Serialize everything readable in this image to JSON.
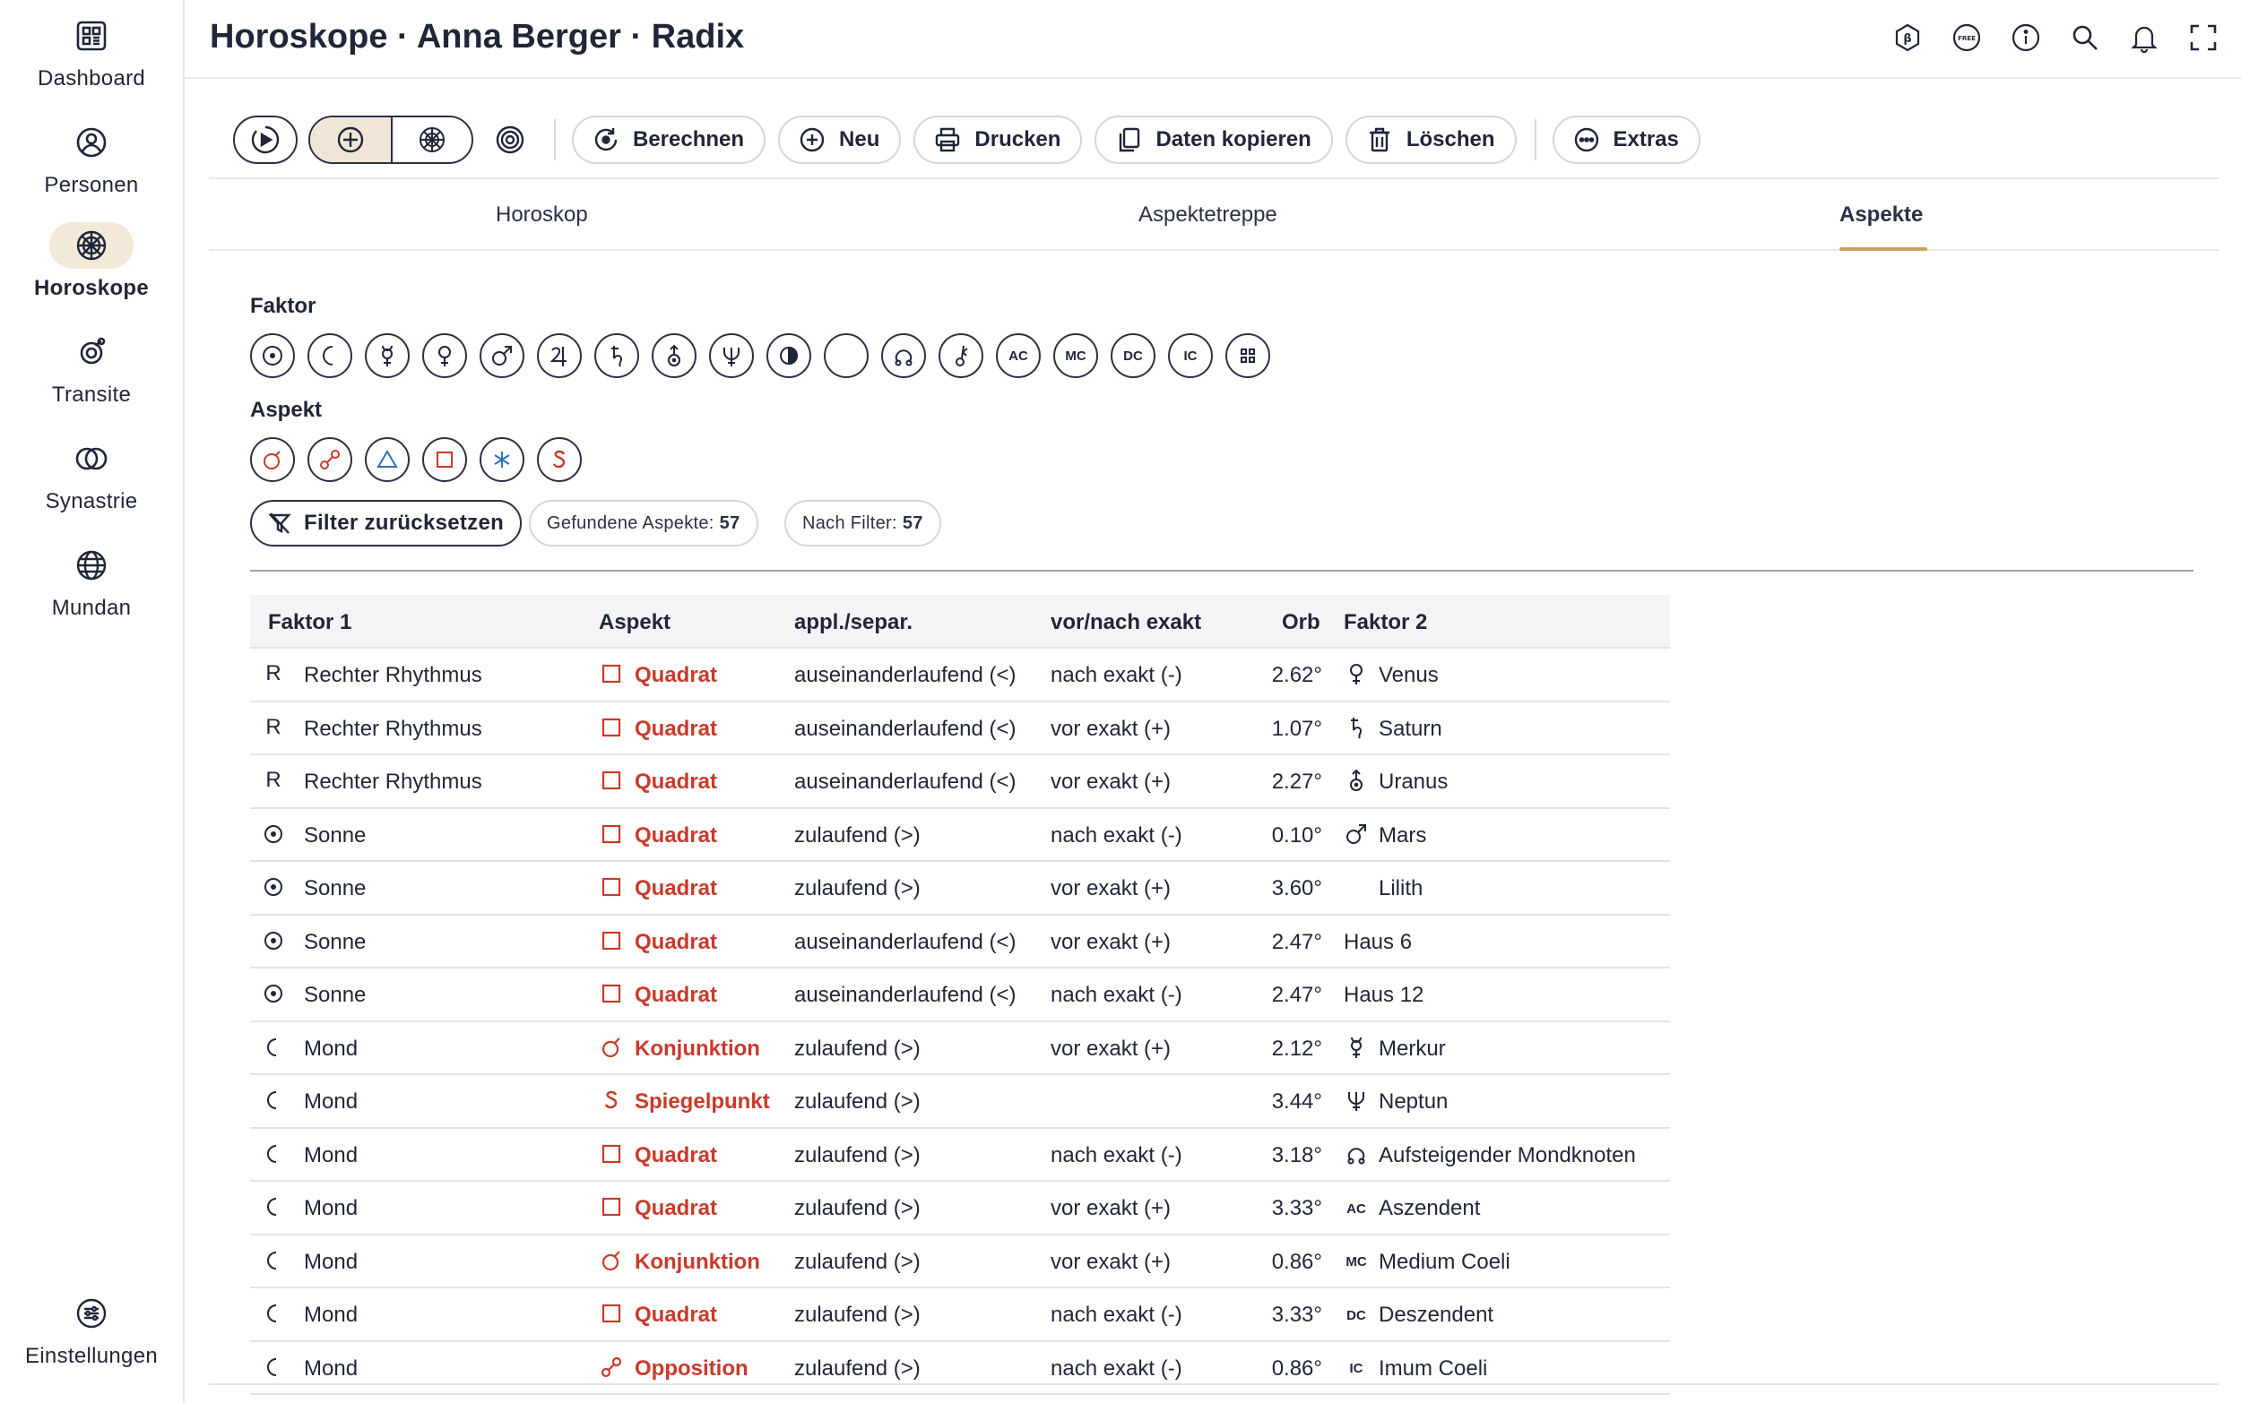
{
  "sidebar": {
    "items": [
      {
        "label": "Dashboard",
        "icon": "dashboard-icon"
      },
      {
        "label": "Personen",
        "icon": "person-icon"
      },
      {
        "label": "Horoskope",
        "icon": "horoscope-wheel-icon",
        "active": true
      },
      {
        "label": "Transite",
        "icon": "transit-icon"
      },
      {
        "label": "Synastrie",
        "icon": "synastry-icon"
      },
      {
        "label": "Mundan",
        "icon": "globe-icon"
      }
    ],
    "settings_label": "Einstellungen"
  },
  "header": {
    "title": "Horoskope · Anna Berger · Radix",
    "icons": [
      "beta-icon",
      "free-icon",
      "info-icon",
      "search-icon",
      "bell-icon",
      "fullscreen-icon"
    ]
  },
  "toolbar": {
    "berechnen": "Berechnen",
    "neu": "Neu",
    "drucken": "Drucken",
    "daten_kopieren": "Daten kopieren",
    "loeschen": "Löschen",
    "extras": "Extras"
  },
  "tabs": [
    {
      "label": "Horoskop"
    },
    {
      "label": "Aspektetreppe"
    },
    {
      "label": "Aspekte",
      "active": true
    }
  ],
  "filters": {
    "faktor_label": "Faktor",
    "aspekt_label": "Aspekt",
    "faktor_chips": [
      "sun",
      "moon",
      "mercury",
      "venus",
      "mars",
      "jupiter",
      "saturn",
      "uranus",
      "neptune",
      "pluto",
      "lilith",
      "node",
      "chiron",
      "AC",
      "MC",
      "DC",
      "IC",
      "more"
    ],
    "aspekt_chips": [
      "conjunction",
      "opposition",
      "trine",
      "square",
      "sextile",
      "mirror"
    ],
    "reset_label": "Filter zurücksetzen",
    "found_label": "Gefundene Aspekte:",
    "found_count": "57",
    "after_filter_label": "Nach Filter:",
    "after_filter_count": "57"
  },
  "table": {
    "headers": {
      "faktor1": "Faktor 1",
      "aspekt": "Aspekt",
      "appl": "appl./separ.",
      "vornach": "vor/nach exakt",
      "orb": "Orb",
      "faktor2": "Faktor 2"
    },
    "rows": [
      {
        "f1_sym": "R",
        "f1": "Rechter Rhythmus",
        "asp_sym": "square",
        "asp": "Quadrat",
        "appl": "auseinanderlaufend (<)",
        "vn": "nach exakt (-)",
        "orb": "2.62°",
        "f2_sym": "venus",
        "f2": "Venus"
      },
      {
        "f1_sym": "R",
        "f1": "Rechter Rhythmus",
        "asp_sym": "square",
        "asp": "Quadrat",
        "appl": "auseinanderlaufend (<)",
        "vn": "vor exakt (+)",
        "orb": "1.07°",
        "f2_sym": "saturn",
        "f2": "Saturn"
      },
      {
        "f1_sym": "R",
        "f1": "Rechter Rhythmus",
        "asp_sym": "square",
        "asp": "Quadrat",
        "appl": "auseinanderlaufend (<)",
        "vn": "vor exakt (+)",
        "orb": "2.27°",
        "f2_sym": "uranus",
        "f2": "Uranus"
      },
      {
        "f1_sym": "sun",
        "f1": "Sonne",
        "asp_sym": "square",
        "asp": "Quadrat",
        "appl": "zulaufend (>)",
        "vn": "nach exakt (-)",
        "orb": "0.10°",
        "f2_sym": "mars",
        "f2": "Mars"
      },
      {
        "f1_sym": "sun",
        "f1": "Sonne",
        "asp_sym": "square",
        "asp": "Quadrat",
        "appl": "zulaufend (>)",
        "vn": "vor exakt (+)",
        "orb": "3.60°",
        "f2_sym": "lilith",
        "f2": "Lilith"
      },
      {
        "f1_sym": "sun",
        "f1": "Sonne",
        "asp_sym": "square",
        "asp": "Quadrat",
        "appl": "auseinanderlaufend (<)",
        "vn": "vor exakt (+)",
        "orb": "2.47°",
        "f2_sym": "",
        "f2": "Haus 6"
      },
      {
        "f1_sym": "sun",
        "f1": "Sonne",
        "asp_sym": "square",
        "asp": "Quadrat",
        "appl": "auseinanderlaufend (<)",
        "vn": "nach exakt (-)",
        "orb": "2.47°",
        "f2_sym": "",
        "f2": "Haus 12"
      },
      {
        "f1_sym": "moon",
        "f1": "Mond",
        "asp_sym": "conjunction",
        "asp": "Konjunktion",
        "appl": "zulaufend (>)",
        "vn": "vor exakt (+)",
        "orb": "2.12°",
        "f2_sym": "mercury",
        "f2": "Merkur"
      },
      {
        "f1_sym": "moon",
        "f1": "Mond",
        "asp_sym": "mirror",
        "asp": "Spiegelpunkt",
        "appl": "zulaufend (>)",
        "vn": "",
        "orb": "3.44°",
        "f2_sym": "neptune",
        "f2": "Neptun"
      },
      {
        "f1_sym": "moon",
        "f1": "Mond",
        "asp_sym": "square",
        "asp": "Quadrat",
        "appl": "zulaufend (>)",
        "vn": "nach exakt (-)",
        "orb": "3.18°",
        "f2_sym": "node",
        "f2": "Aufsteigender Mondknoten"
      },
      {
        "f1_sym": "moon",
        "f1": "Mond",
        "asp_sym": "square",
        "asp": "Quadrat",
        "appl": "zulaufend (>)",
        "vn": "vor exakt (+)",
        "orb": "3.33°",
        "f2_sym": "AC",
        "f2": "Aszendent"
      },
      {
        "f1_sym": "moon",
        "f1": "Mond",
        "asp_sym": "conjunction",
        "asp": "Konjunktion",
        "appl": "zulaufend (>)",
        "vn": "vor exakt (+)",
        "orb": "0.86°",
        "f2_sym": "MC",
        "f2": "Medium Coeli"
      },
      {
        "f1_sym": "moon",
        "f1": "Mond",
        "asp_sym": "square",
        "asp": "Quadrat",
        "appl": "zulaufend (>)",
        "vn": "nach exakt (-)",
        "orb": "3.33°",
        "f2_sym": "DC",
        "f2": "Deszendent"
      },
      {
        "f1_sym": "moon",
        "f1": "Mond",
        "asp_sym": "opposition",
        "asp": "Opposition",
        "appl": "zulaufend (>)",
        "vn": "nach exakt (-)",
        "orb": "0.86°",
        "f2_sym": "IC",
        "f2": "Imum Coeli"
      }
    ]
  },
  "colors": {
    "accent": "#c9a263",
    "aspect_red": "#c93a2a",
    "aspect_blue": "#2f6fb8",
    "text": "#1f2638"
  }
}
